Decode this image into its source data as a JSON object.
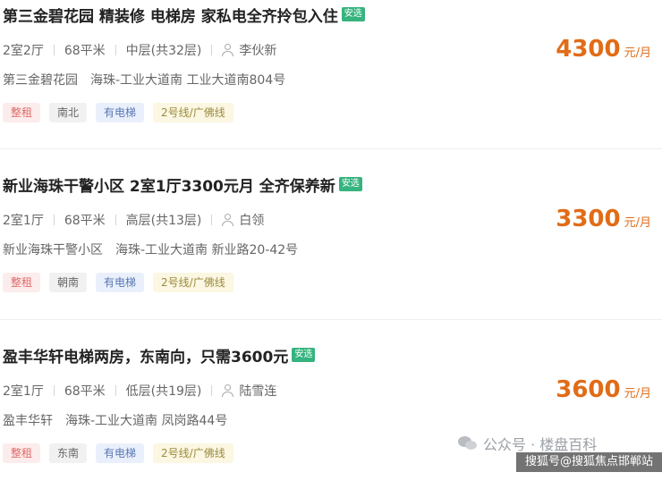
{
  "listings": [
    {
      "title": "第三金碧花园 精装修 电梯房 家私电全齐拎包入住",
      "badge": "安选",
      "layout": "2室2厅",
      "area": "68平米",
      "floor": "中层(共32层)",
      "agent": "李伙新",
      "community": "第三金碧花园",
      "address": "海珠-工业大道南 工业大道南804号",
      "tags": [
        "整租",
        "南北",
        "有电梯",
        "2号线/广佛线"
      ],
      "price": "4300",
      "price_unit": "元/月"
    },
    {
      "title": "新业海珠干警小区 2室1厅3300元月 全齐保养新",
      "badge": "安选",
      "layout": "2室1厅",
      "area": "68平米",
      "floor": "高层(共13层)",
      "agent": "白领",
      "community": "新业海珠干警小区",
      "address": "海珠-工业大道南 新业路20-42号",
      "tags": [
        "整租",
        "朝南",
        "有电梯",
        "2号线/广佛线"
      ],
      "price": "3300",
      "price_unit": "元/月"
    },
    {
      "title": "盈丰华轩电梯两房，东南向，只需3600元",
      "badge": "安选",
      "layout": "2室1厅",
      "area": "68平米",
      "floor": "低层(共19层)",
      "agent": "陆雪连",
      "community": "盈丰华轩",
      "address": "海珠-工业大道南 凤岗路44号",
      "tags": [
        "整租",
        "东南",
        "有电梯",
        "2号线/广佛线"
      ],
      "price": "3600",
      "price_unit": "元/月"
    }
  ],
  "watermark": {
    "text": "公众号 · 楼盘百科",
    "icon": "wechat-icon"
  },
  "source_label": "搜狐号@搜狐焦点邯郸站",
  "colors": {
    "price": "#e16c17",
    "badge": "#36b37e",
    "tag_zhengzu": "#e06a6a",
    "tag_elevator": "#5977b5",
    "tag_metro": "#9b8a3d"
  }
}
